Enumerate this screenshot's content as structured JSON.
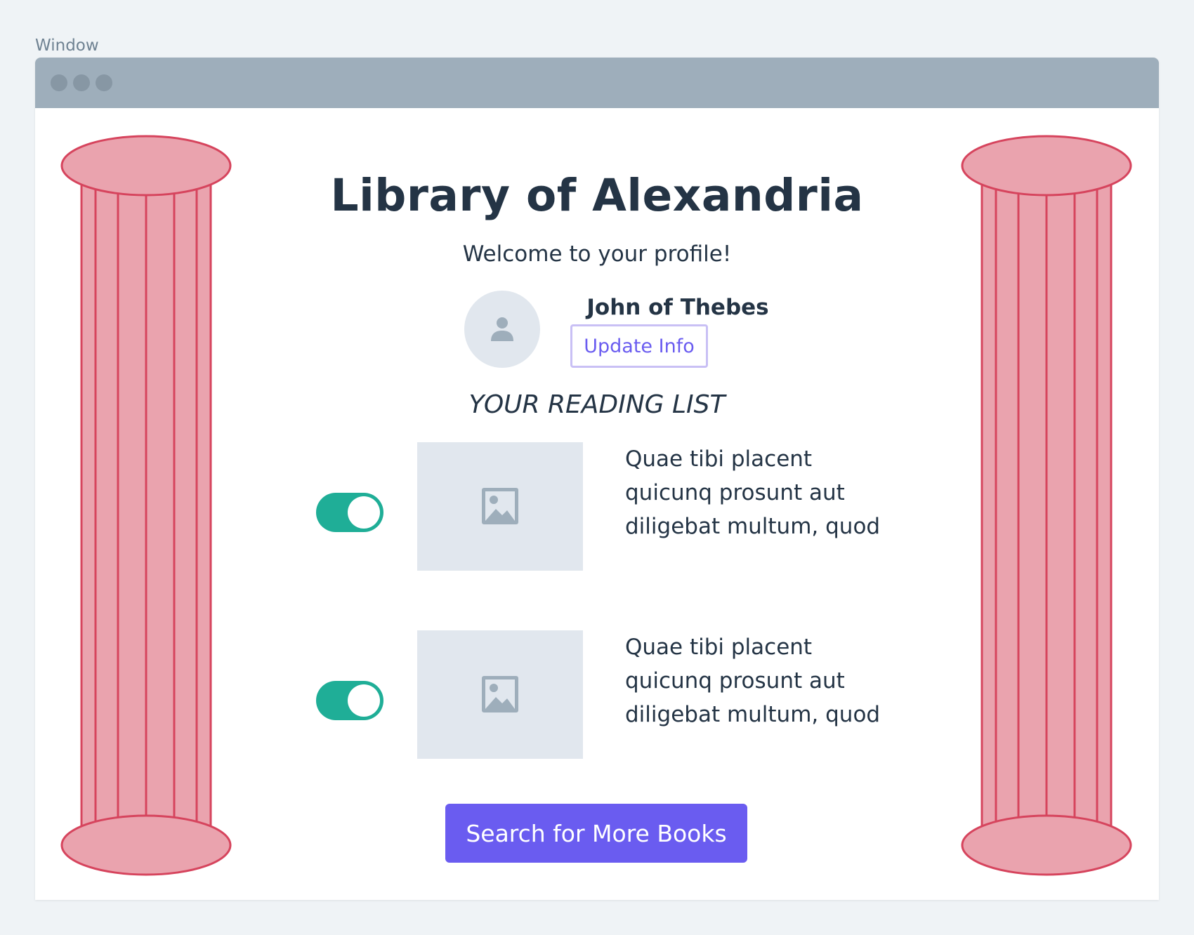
{
  "window": {
    "label": "Window"
  },
  "profile": {
    "title": "Library of Alexandria",
    "welcome": "Welcome to your profile!",
    "user_name": "John of Thebes",
    "update_button_label": "Update Info"
  },
  "reading_list": {
    "heading": "YOUR READING LIST",
    "items": [
      {
        "enabled": true,
        "line1": "Quae tibi placent",
        "line2": "quicunq prosunt aut",
        "line3": "diligebat multum, quod",
        "thumbnail_icon": "image-icon"
      },
      {
        "enabled": true,
        "line1": "Quae tibi placent",
        "line2": "quicunq prosunt aut",
        "line3": "diligebat multum, quod",
        "thumbnail_icon": "image-icon"
      }
    ]
  },
  "search_button_label": "Search for More Books",
  "colors": {
    "accent": "#6a5cf0",
    "toggle_on": "#1fae97",
    "pillar_fill": "#eaa3ae",
    "pillar_stroke": "#d6445d",
    "titlebar": "#9eaebb",
    "text": "#243445"
  }
}
